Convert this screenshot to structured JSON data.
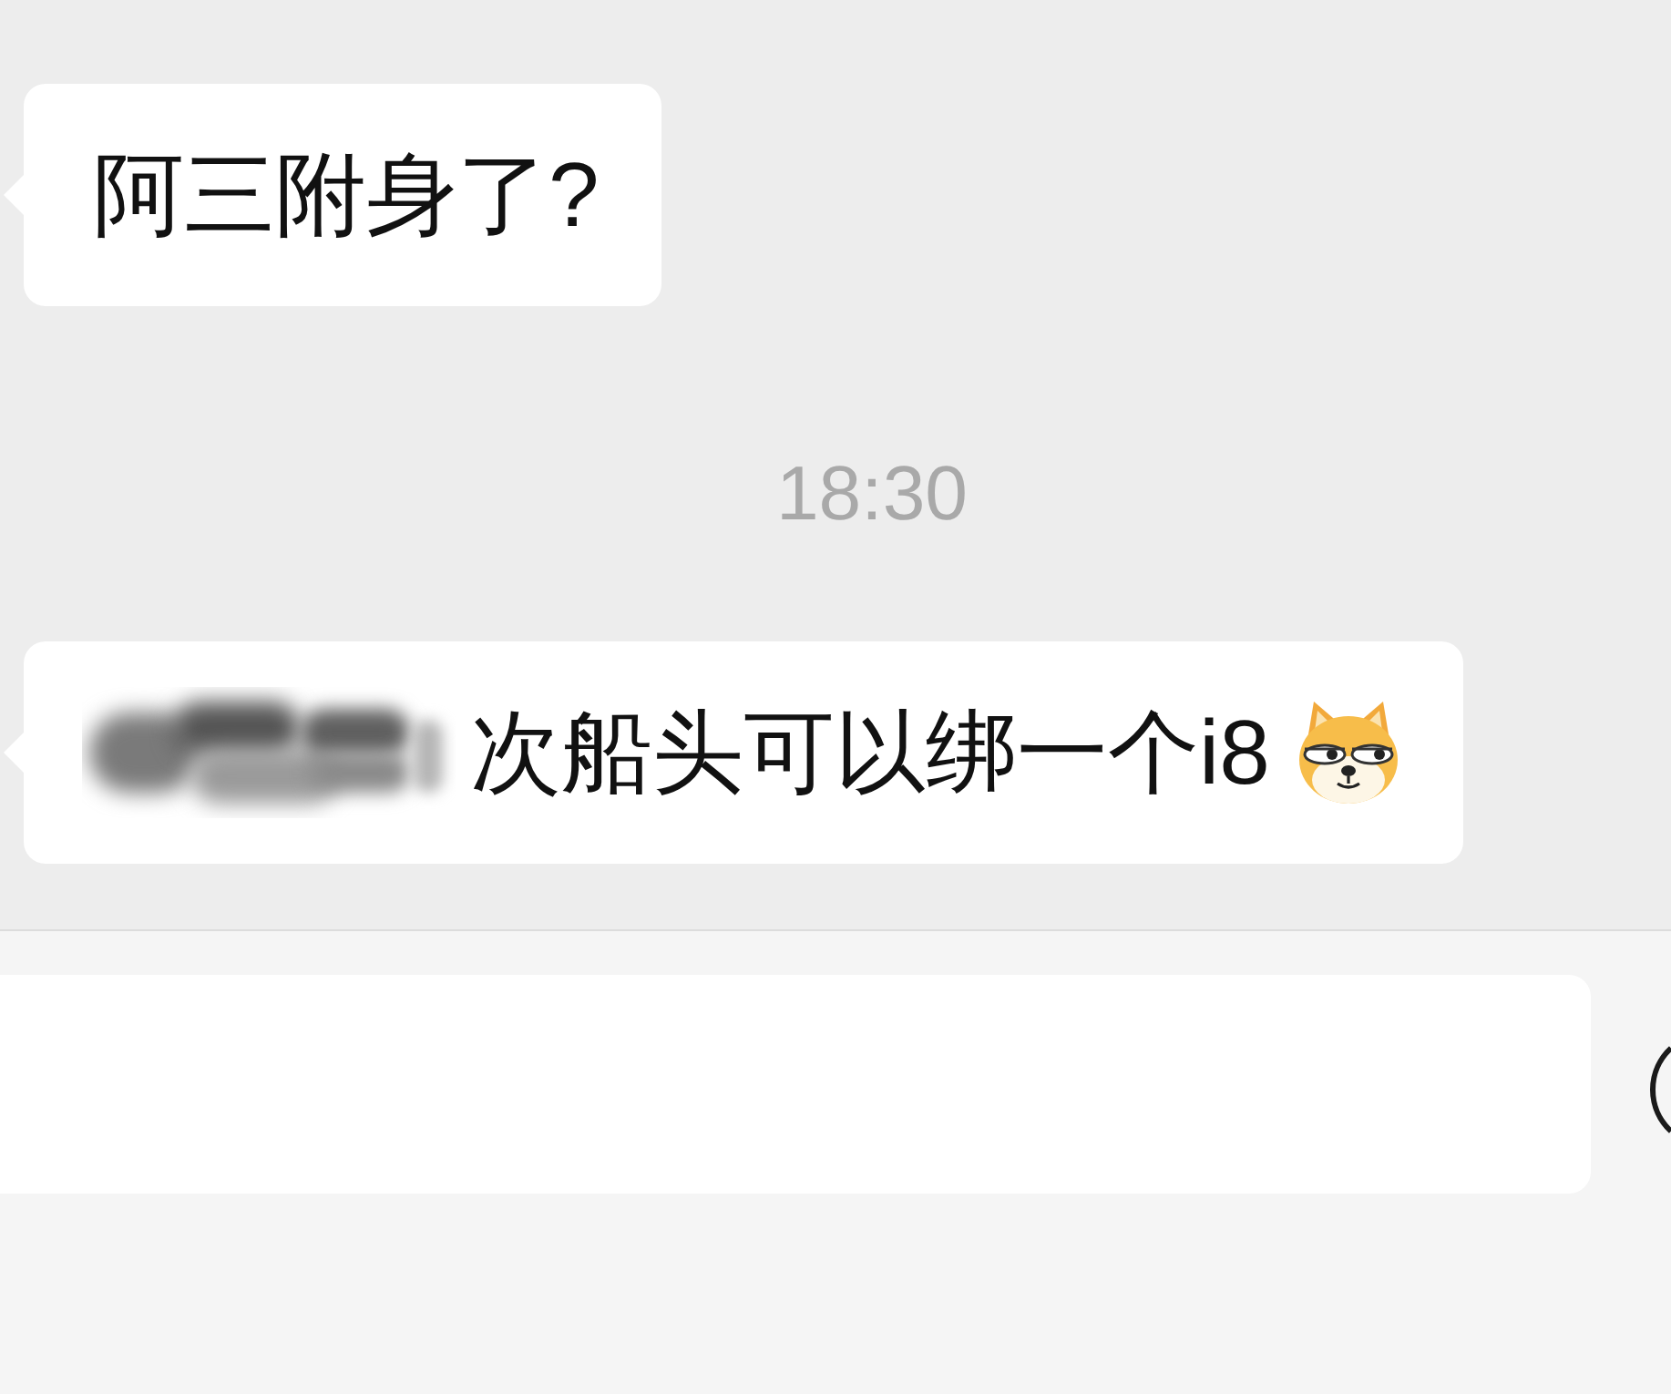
{
  "messages": [
    {
      "kind": "text",
      "text": "阿三附身了?"
    },
    {
      "kind": "timestamp",
      "text": "18:30"
    },
    {
      "kind": "text",
      "text": "次船头可以绑一个i8",
      "redacted": true,
      "trailing_emoji": true
    }
  ]
}
